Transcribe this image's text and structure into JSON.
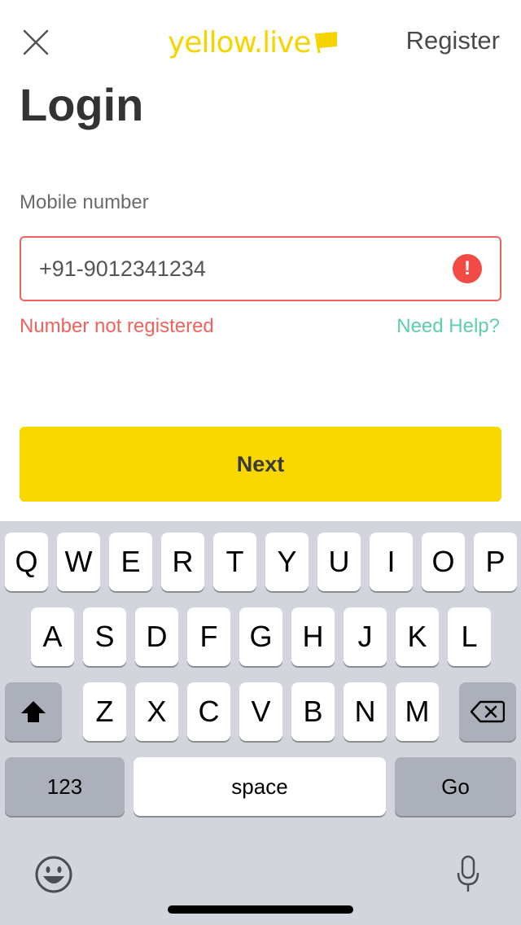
{
  "header": {
    "logo_text": "yellow.live",
    "register_label": "Register",
    "close_icon": "close-icon"
  },
  "login": {
    "title": "Login",
    "mobile_label": "Mobile number",
    "mobile_value": "+91-9012341234",
    "error_icon_glyph": "!",
    "error_message": "Number not registered",
    "help_label": "Need Help?",
    "next_label": "Next"
  },
  "colors": {
    "brand_yellow": "#f8d800",
    "error_red": "#f0625c",
    "help_green": "#5fd0a6"
  },
  "keyboard": {
    "row1": [
      "Q",
      "W",
      "E",
      "R",
      "T",
      "Y",
      "U",
      "I",
      "O",
      "P"
    ],
    "row2": [
      "A",
      "S",
      "D",
      "F",
      "G",
      "H",
      "J",
      "K",
      "L"
    ],
    "row3": [
      "Z",
      "X",
      "C",
      "V",
      "B",
      "N",
      "M"
    ],
    "numbers_label": "123",
    "space_label": "space",
    "go_label": "Go",
    "shift_icon": "shift-icon",
    "backspace_icon": "backspace-icon",
    "emoji_icon": "emoji-icon",
    "mic_icon": "microphone-icon"
  }
}
